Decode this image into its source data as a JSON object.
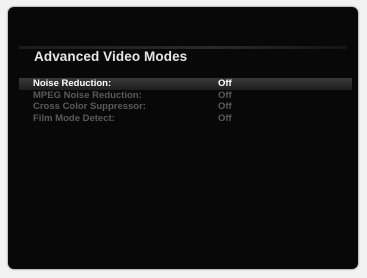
{
  "menu": {
    "title": "Advanced Video Modes",
    "items": [
      {
        "label": "Noise Reduction:",
        "value": "Off",
        "selected": true
      },
      {
        "label": "MPEG Noise Reduction:",
        "value": "Off",
        "selected": false
      },
      {
        "label": "Cross Color Suppressor:",
        "value": "Off",
        "selected": false
      },
      {
        "label": "Film Mode Detect:",
        "value": "Off",
        "selected": false
      }
    ]
  },
  "colors": {
    "background": "#080808",
    "selected_text": "#ffffff",
    "inactive_text": "#5a5a5a",
    "title_text": "#e6e6e6"
  }
}
